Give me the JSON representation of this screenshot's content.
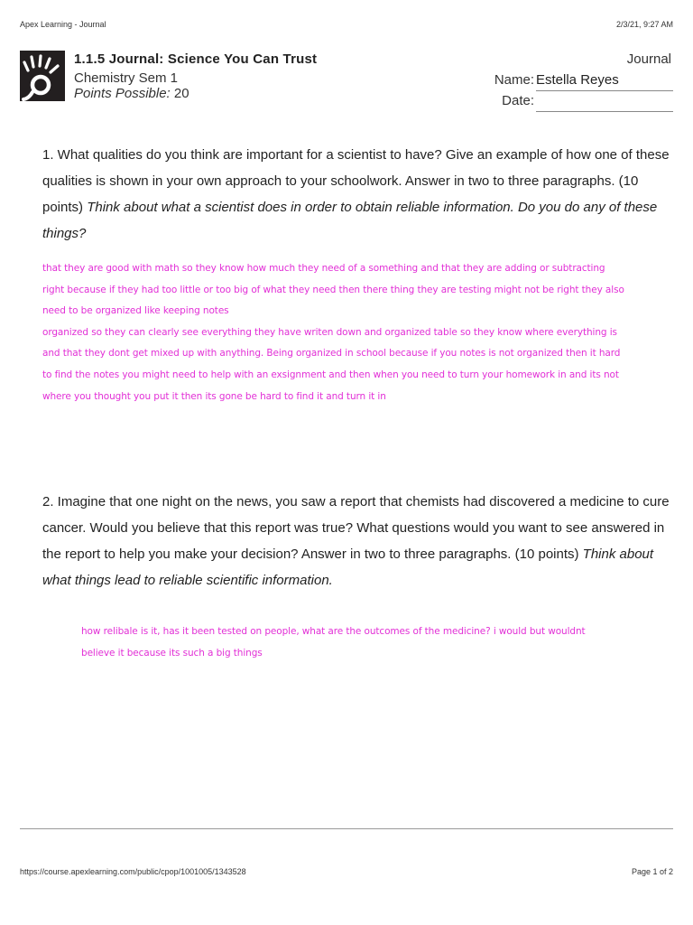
{
  "print_header": {
    "title": "Apex Learning - Journal",
    "datetime": "2/3/21, 9:27 AM"
  },
  "doc": {
    "title": "1.1.5  Journal:  Science You Can Trust",
    "course": "Chemistry Sem 1",
    "points_label": "Points Possible:",
    "points_value": " 20",
    "type": "Journal",
    "name_label": "Name:",
    "name_value": "Estella Reyes",
    "date_label": "Date:",
    "date_value": ""
  },
  "questions": [
    {
      "prompt": "1. What qualities do you think are important for a scientist to have? Give an example of how one of these qualities is shown in your own approach to your schoolwork. Answer in two to three paragraphs. (10 points) ",
      "hint": "Think about what a scientist does in order to obtain reliable information. Do you do any of these things?",
      "answer_lines": [
        "that they are good with math so they know how much they need of a something and that they are adding or subtracting",
        "right because if they had too little or too big of what they need then there thing they are testing might not be right  they also",
        "need to be organized like keeping notes",
        "organized so they can clearly see everything they have writen down and organized table so they know where everything is",
        "and that they dont get mixed up with anything. Being organized in school because if you notes is not organized then it hard",
        "to find the notes you might need to help with an exsignment and then when you need to turn your homework in and its not",
        "where you thought you put it then its gone be hard to find it and turn it in"
      ]
    },
    {
      "prompt": "2. Imagine that one night on the news, you saw a report that chemists had discovered a medicine to cure cancer. Would you believe that this report was true? What questions would you want to see answered in the report to help you make your decision? Answer in two to three paragraphs. (10 points) ",
      "hint": "Think about what things lead to reliable scientific information.",
      "answer_lines": [
        "how relibale is it, has it been tested on people, what are the outcomes of the medicine? i would but wouldnt",
        "believe it because its such a big things"
      ]
    }
  ],
  "footer": {
    "url": "https://course.apexlearning.com/public/cpop/1001005/1343528",
    "page": "Page 1 of 2"
  },
  "colors": {
    "answer_ink": "#e22fd6",
    "text": "#222222"
  },
  "icons": {
    "logo": "apex-learning-logo-icon"
  }
}
